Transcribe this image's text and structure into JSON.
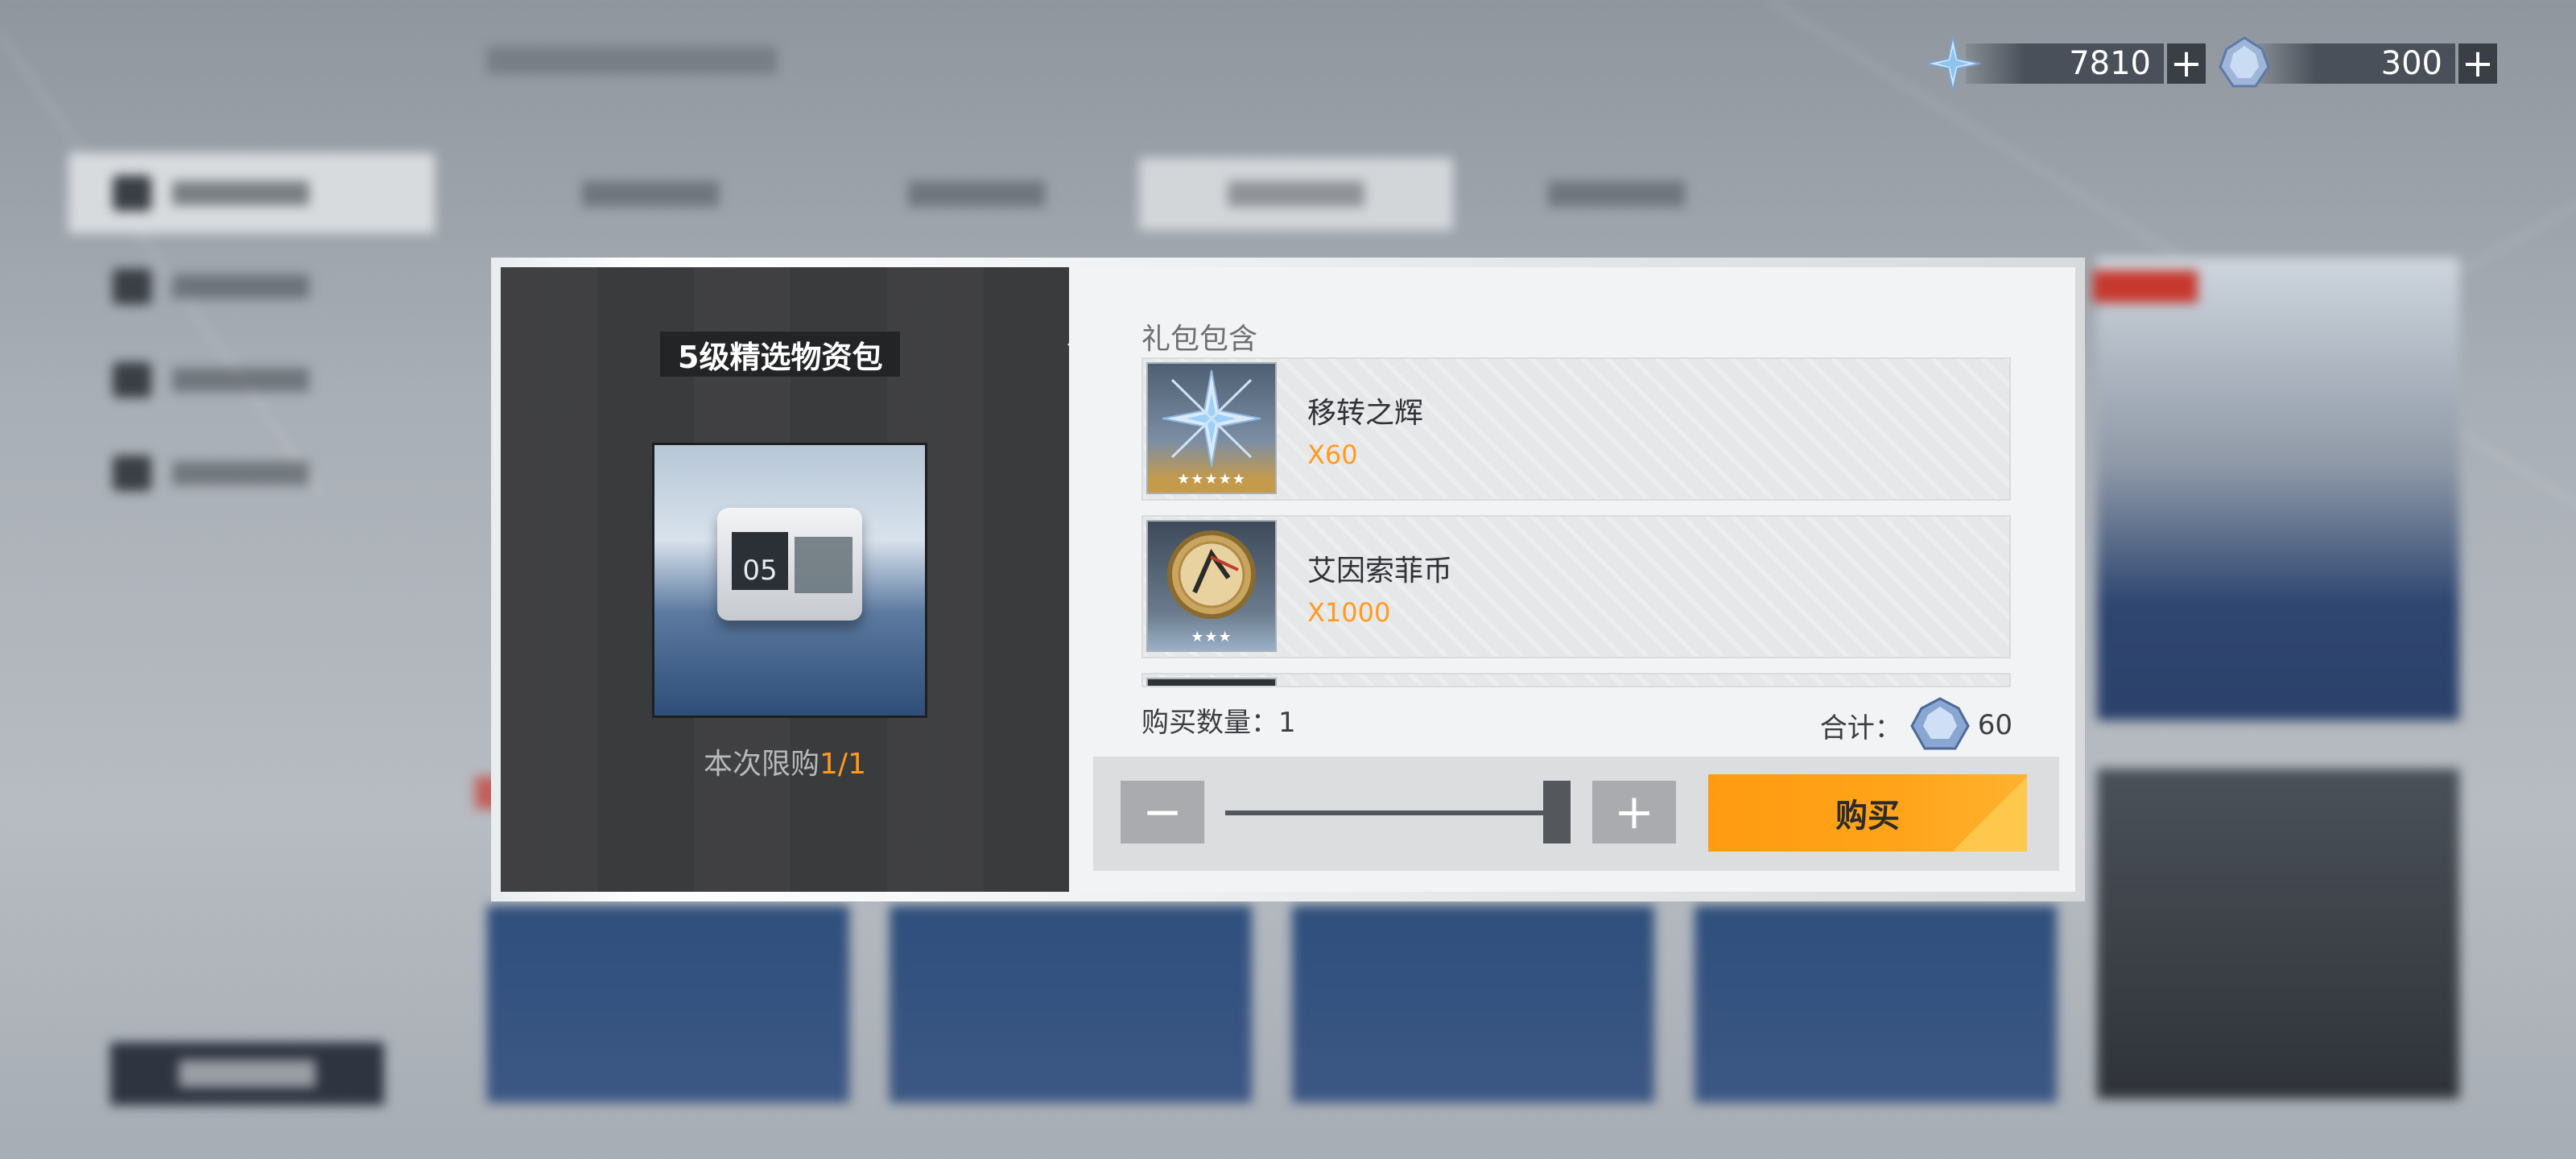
{
  "currencies": [
    {
      "icon": "transfer-glow-icon",
      "value": "7810",
      "plus": "+"
    },
    {
      "icon": "crystal-gem-icon",
      "value": "300",
      "plus": "+"
    }
  ],
  "modal": {
    "title": "5级精选物资包",
    "limit_prefix": "本次限购",
    "limit_value": "1/1",
    "contents_label": "礼包包含",
    "items": [
      {
        "name": "移转之辉",
        "qty": "X60",
        "stars": "★★★★★",
        "icon": "transfer-glow-icon"
      },
      {
        "name": "艾因索菲币",
        "qty": "X1000",
        "stars": "★★★",
        "icon": "coin-icon"
      }
    ],
    "buy_count_label": "购买数量：",
    "buy_count": "1",
    "total_label": "合计：",
    "total_value": "60",
    "buy_label": "购买",
    "quantity_fraction": 1.0
  },
  "colors": {
    "accent": "#ff9b10",
    "modal_bg": "#f2f3f4",
    "left_panel": "#3b3c3e"
  }
}
